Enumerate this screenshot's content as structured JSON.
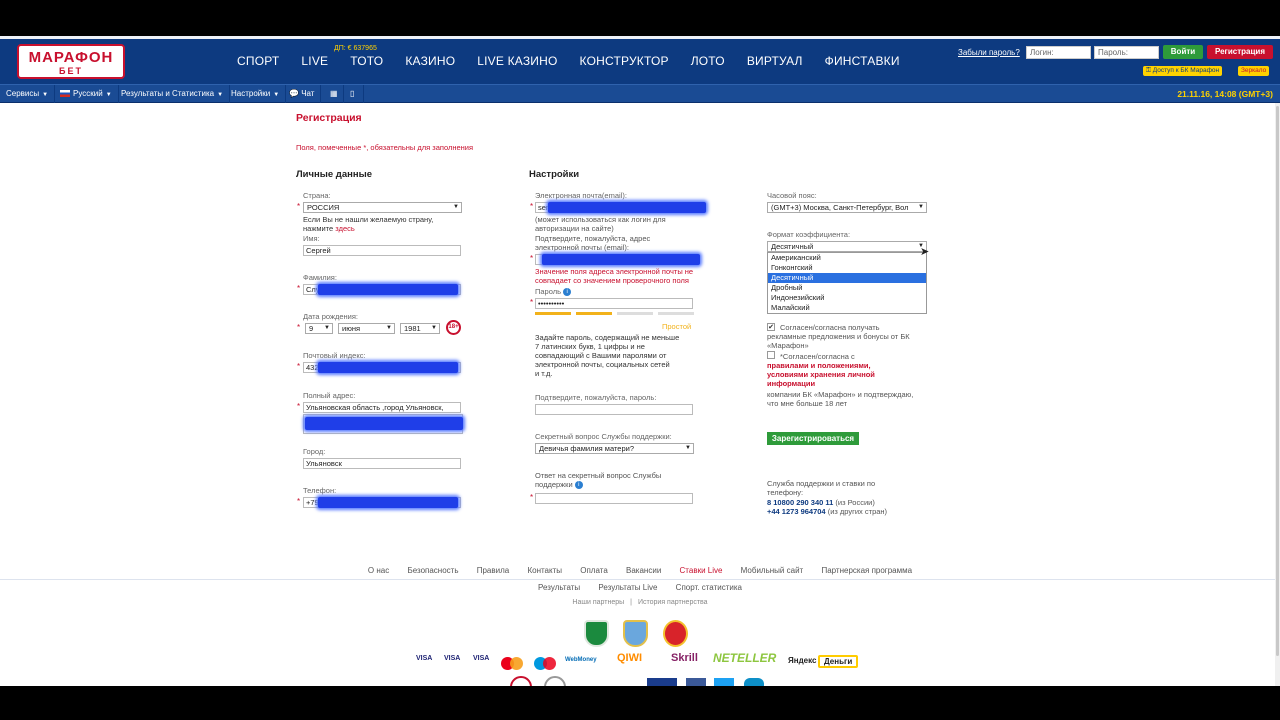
{
  "header": {
    "logo_top": "МАРАФОН",
    "logo_bottom": "БЕТ",
    "nav": [
      "СПОРТ",
      "LIVE",
      "ТОТО",
      "КАЗИНО",
      "LIVE КАЗИНО",
      "КОНСТРУКТОР",
      "ЛОТО",
      "ВИРТУАЛ",
      "ФИНСТАВКИ"
    ],
    "toto_jackpot": "ДП: € 637965",
    "forgot_password": "Забыли пароль?",
    "login_placeholder": "Логин:",
    "password_placeholder": "Пароль:",
    "login_button": "Войти",
    "register_button": "Регистрация",
    "access_label": "Доступ к БК Марафон",
    "mirror_label": "Зеркало"
  },
  "subnav": {
    "services": "Сервисы",
    "language": "Русский",
    "results": "Результаты и Статистика",
    "settings": "Настройки",
    "chat": "Чат",
    "datetime": "21.11.16, 14:08 (GMT+3)"
  },
  "page": {
    "title": "Регистрация",
    "required_note": "Поля, помеченные *, обязательны для заполнения"
  },
  "personal": {
    "heading": "Личные данные",
    "country_label": "Страна:",
    "country_value": "РОССИЯ",
    "country_hint_1": "Если Вы не нашли желаемую страну,",
    "country_hint_2": "нажмите",
    "country_hint_link": "здесь",
    "name_label": "Имя:",
    "name_value": "Сергей",
    "surname_label": "Фамилия:",
    "surname_value": "Слу",
    "dob_label": "Дата рождения:",
    "dob_day": "9",
    "dob_month": "июня",
    "dob_year": "1981",
    "age_badge": "18+",
    "zip_label": "Почтовый индекс:",
    "zip_value": "432",
    "address_label": "Полный адрес:",
    "address_value": "Ульяновская область ,город Ульяновск,",
    "city_label": "Город:",
    "city_value": "Ульяновск",
    "phone_label": "Телефон:",
    "phone_value": "+79"
  },
  "settings": {
    "heading": "Настройки",
    "email_label": "Электронная почта(email):",
    "email_value": "ser",
    "email_hint": [
      "(может использоваться как логин для",
      "авторизации на сайте)"
    ],
    "confirm_email_label": [
      "Подтвердите, пожалуйста, адрес",
      "электронной почты (email):"
    ],
    "email_error": [
      "Значение поля адреса электронной почты не",
      "совпадает со значением проверочного поля"
    ],
    "password_label": "Пароль",
    "password_value": "••••••••••",
    "strength_label": "Простой",
    "password_hint": [
      "Задайте пароль, содержащий не меньше",
      "7 латинских букв, 1 цифры и не",
      "совпадающий с Вашими паролями от",
      "электронной почты, социальных сетей",
      "и т.д."
    ],
    "confirm_password_label": "Подтвердите, пожалуйста, пароль:",
    "secret_question_label": "Секретный вопрос Службы поддержки:",
    "secret_question_value": "Девичья фамилия матери?",
    "secret_answer_label": [
      "Ответ на секретный вопрос Службы",
      "поддержки"
    ]
  },
  "prefs": {
    "timezone_label": "Часовой пояс:",
    "timezone_value": "(GMT+3) Москва, Санкт-Петербург, Вол",
    "odds_label": "Формат коэффициента:",
    "odds_value": "Десятичный",
    "odds_options": [
      "Американский",
      "Гонконгский",
      "Десятичный",
      "Дробный",
      "Индонезийский",
      "Малайский"
    ],
    "odds_selected_index": 2,
    "promo_consent": [
      "Согласен/согласна получать",
      "рекламные предложения и бонусы от БК",
      "«Марафон»"
    ],
    "terms_consent_1": "*Согласен/согласна с",
    "terms_link_1": "правилами и положениями,",
    "terms_link_2": "условиями хранения личной",
    "terms_link_3": "информации",
    "terms_consent_2": [
      "компании БК «Марафон» и подтверждаю,",
      "что мне больше 18 лет"
    ],
    "submit_button": "Зарегистрироваться",
    "support_text": [
      "Служба поддержки и ставки по",
      "телефону:"
    ],
    "phone_ru": "8 10800 290 340 11",
    "phone_ru_note": "(из России)",
    "phone_intl": "+44 1273 964704",
    "phone_intl_note": "(из других стран)"
  },
  "footer": {
    "links_row1": [
      "О нас",
      "Безопасность",
      "Правила",
      "Контакты",
      "Оплата",
      "Вакансии",
      "Ставки Live",
      "Мобильный сайт",
      "Партнерская программа"
    ],
    "links_row2": [
      "Результаты",
      "Результаты Live",
      "Спорт. статистика"
    ],
    "links_row3": [
      "Наши партнеры",
      "|",
      "История партнерства"
    ],
    "payments": [
      "VISA",
      "VISA",
      "VISA",
      "WebMoney",
      "QIWI",
      "Skrill",
      "NETELLER",
      "Яндекс",
      "Деньги"
    ]
  },
  "colors": {
    "brand_blue": "#0d3a80",
    "brand_red": "#c8102e",
    "accent_yellow": "#ffd200",
    "green": "#2e9b3a",
    "redaction_blue": "#1f3ee8"
  }
}
